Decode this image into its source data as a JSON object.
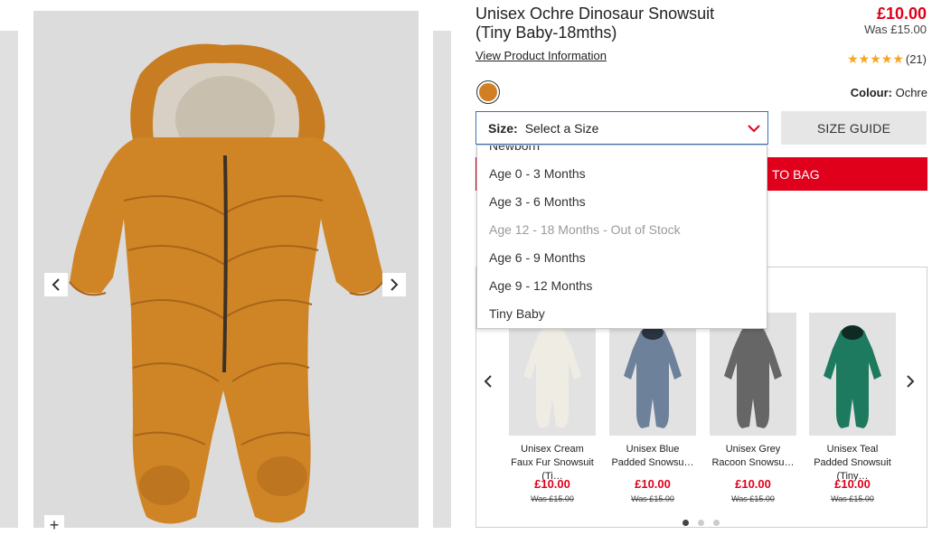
{
  "product": {
    "title_line1": "Unisex Ochre Dinosaur Snowsuit",
    "title_line2": "(Tiny Baby-18mths)",
    "price": "£10.00",
    "was_price": "Was £15.00",
    "view_info": "View Product Information",
    "rating_stars": "★★★★★",
    "rating": 5,
    "review_count": "(21)",
    "colour_label": "Colour:",
    "colour_value": "Ochre",
    "swatch_color": "#d07f22"
  },
  "size": {
    "label": "Size:",
    "value": "Select a Size",
    "options": [
      "Newborn",
      "Age 0 - 3 Months",
      "Age 3 - 6 Months",
      "Age 12 - 18 Months - Out of Stock",
      "Age 6 - 9 Months",
      "Age 9 - 12 Months",
      "Tiny Baby"
    ]
  },
  "size_guide_label": "SIZE GUIDE",
  "add_to_bag_label": "TO BAG",
  "gallery": {
    "zoom_symbol": "+"
  },
  "recommendations": [
    {
      "name": "Unisex Cream Faux Fur Snowsuit (Ti…",
      "price": "£10.00",
      "was": "Was £15.00",
      "color": "#efece4"
    },
    {
      "name": "Unisex Blue Padded Snowsu…",
      "price": "£10.00",
      "was": "Was £15.00",
      "color": "#6d819a"
    },
    {
      "name": "Unisex Grey Racoon Snowsu…",
      "price": "£10.00",
      "was": "Was £15.00",
      "color": "#666666"
    },
    {
      "name": "Unisex Teal Padded Snowsuit (Tiny…",
      "price": "£10.00",
      "was": "Was £15.00",
      "color": "#1d7a5e"
    }
  ],
  "colors": {
    "accent_red": "#e0001b",
    "star": "#f5a623",
    "select_border": "#3c6fb5"
  }
}
